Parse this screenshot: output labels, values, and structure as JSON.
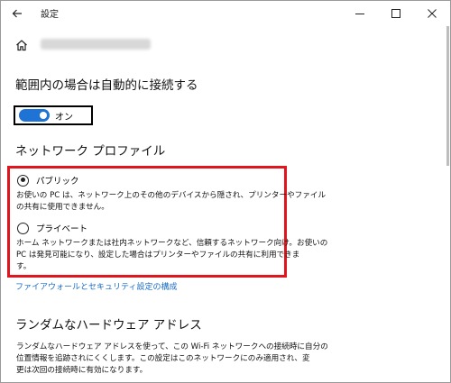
{
  "window": {
    "title": "設定"
  },
  "header": {
    "network_name_blurred": ""
  },
  "auto_connect": {
    "heading": "範囲内の場合は自動的に接続する",
    "toggle_state_label": "オン",
    "enabled": true
  },
  "network_profile": {
    "heading": "ネットワーク プロファイル",
    "options": [
      {
        "label": "パブリック",
        "selected": true,
        "description_lines": [
          "お使いの PC は、ネットワーク上のその他のデバイスから隠され、プリンターやファイル",
          "の共有に使用できません。"
        ]
      },
      {
        "label": "プライベート",
        "selected": false,
        "description_lines": [
          "ホーム ネットワークまたは社内ネットワークなど、信頼するネットワーク向け。お使いの",
          "PC は発見可能になり、設定した場合はプリンターやファイルの共有に利用できま",
          "す。"
        ]
      }
    ],
    "link_text": "ファイアウォールとセキュリティ設定の構成"
  },
  "random_hw": {
    "heading": "ランダムなハードウェア アドレス",
    "description_lines": [
      "ランダムなハードウェア アドレスを使って、この Wi-Fi ネットワークへの接続時に自分の",
      "位置情報を追跡されにくくします。この設定はこのネットワークにのみ適用され、変",
      "更は次回の接続時に有効になります。"
    ]
  },
  "colors": {
    "accent": "#1e73d4",
    "highlight_border": "#e0161e",
    "link": "#1a6dc9"
  },
  "icons": [
    "back-arrow-icon",
    "minimize-icon",
    "maximize-icon",
    "close-icon",
    "home-icon"
  ]
}
